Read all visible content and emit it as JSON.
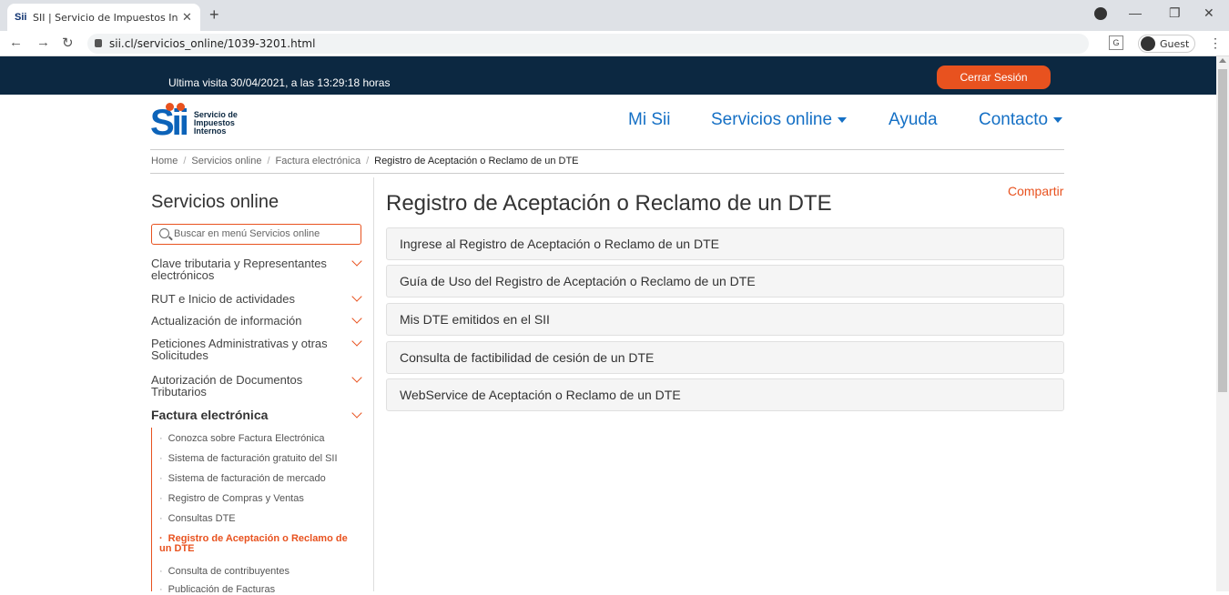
{
  "browser": {
    "tab_title": "SII | Servicio de Impuestos Internos",
    "tab_favicon": "Sii",
    "url": "sii.cl/servicios_online/1039-3201.html",
    "guest_label": "Guest"
  },
  "header": {
    "last_visit": "Ultima visita 30/04/2021, a las 13:29:18 horas",
    "logout_label": "Cerrar Sesión",
    "logo_word": "Sii",
    "logo_line1": "Servicio de",
    "logo_line2": "Impuestos",
    "logo_line3": "Internos",
    "nav": {
      "mi_sii": "Mi Sii",
      "servicios": "Servicios online",
      "ayuda": "Ayuda",
      "contacto": "Contacto"
    }
  },
  "breadcrumb": {
    "home": "Home",
    "servicios": "Servicios online",
    "factura": "Factura electrónica",
    "current": "Registro de Aceptación o Reclamo de un DTE"
  },
  "sidebar": {
    "title": "Servicios online",
    "search_placeholder": "Buscar en menú Servicios online",
    "items": [
      "Clave tributaria y Representantes electrónicos",
      "RUT e Inicio de actividades",
      "Actualización de información",
      "Peticiones Administrativas y otras Solicitudes",
      "Autorización de Documentos Tributarios",
      "Factura electrónica"
    ],
    "subitems": [
      "Conozca sobre Factura Electrónica",
      "Sistema de facturación gratuito del SII",
      "Sistema de facturación de mercado",
      "Registro de Compras y Ventas",
      "Consultas DTE",
      "Registro de Aceptación o Reclamo de un DTE",
      "Consulta de contribuyentes",
      "Publicación de Facturas"
    ]
  },
  "main": {
    "title": "Registro de Aceptación o Reclamo de un DTE",
    "share_label": "Compartir",
    "links": [
      "Ingrese al Registro de Aceptación o Reclamo de un DTE",
      "Guía de Uso del Registro de Aceptación o Reclamo de un DTE",
      "Mis DTE emitidos en el SII",
      "Consulta de factibilidad de cesión de un DTE",
      "WebService de Aceptación o Reclamo de un DTE"
    ]
  },
  "colors": {
    "accent": "#e8521f",
    "brand_blue": "#1570c5",
    "banner": "#0c2841"
  }
}
